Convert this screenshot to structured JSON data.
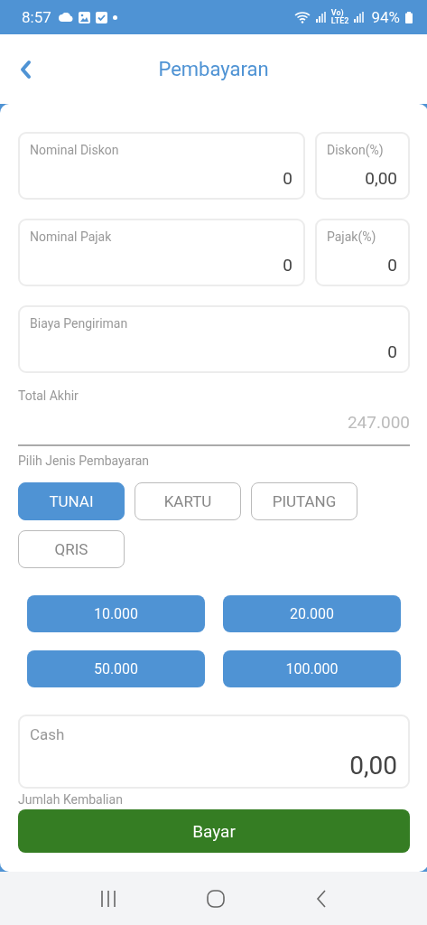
{
  "status_bar": {
    "time": "8:57",
    "network_label": [
      "Vo)",
      "LTE2"
    ],
    "battery": "94%"
  },
  "header": {
    "title": "Pembayaran"
  },
  "field_rows": [
    {
      "fields": [
        {
          "label": "Nominal Diskon",
          "value": "0"
        },
        {
          "label": "Diskon(%)",
          "value": "0,00"
        }
      ]
    },
    {
      "fields": [
        {
          "label": "Nominal Pajak",
          "value": "0"
        },
        {
          "label": "Pajak(%)",
          "value": "0"
        }
      ]
    },
    {
      "fields": [
        {
          "label": "Biaya Pengiriman",
          "value": "0"
        }
      ]
    }
  ],
  "total": {
    "label": "Total Akhir",
    "value": "247.000"
  },
  "payment_type": {
    "label": "Pilih Jenis Pembayaran",
    "options": [
      {
        "label": "TUNAI",
        "selected": true
      },
      {
        "label": "KARTU",
        "selected": false
      },
      {
        "label": "PIUTANG",
        "selected": false
      },
      {
        "label": "QRIS",
        "selected": false
      }
    ]
  },
  "quick_amounts": [
    "10.000",
    "20.000",
    "50.000",
    "100.000"
  ],
  "cash": {
    "label": "Cash",
    "value": "0,00"
  },
  "change_label": "Jumlah Kembalian",
  "pay_button": "Bayar"
}
